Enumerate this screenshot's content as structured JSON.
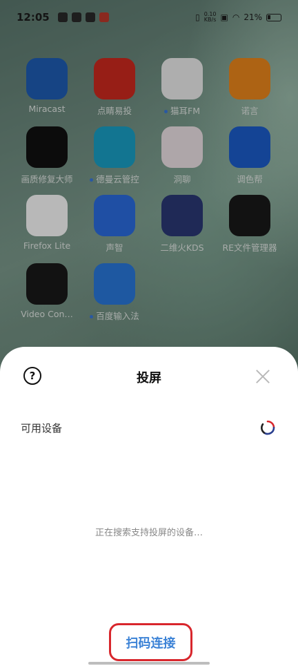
{
  "status_bar": {
    "time": "12:05",
    "net_speed_value": "0.10",
    "net_speed_unit": "KB/s",
    "battery": "21%"
  },
  "apps": [
    {
      "label": "Miracast",
      "dot": false,
      "icon": "miracast-icon",
      "color": "#1f5fb8"
    },
    {
      "label": "点睛易投",
      "dot": false,
      "icon": "dianjing-icon",
      "color": "#d12a1f"
    },
    {
      "label": "猫耳FM",
      "dot": true,
      "icon": "maoer-icon",
      "color": "#f2f2f2"
    },
    {
      "label": "诺言",
      "dot": false,
      "icon": "nuoyan-icon",
      "color": "#f08a1d"
    },
    {
      "label": "画质修复大师",
      "dot": false,
      "icon": "huazhi-icon",
      "color": "#111111"
    },
    {
      "label": "德曼云管控",
      "dot": true,
      "icon": "deman-icon",
      "color": "#1aa3c9"
    },
    {
      "label": "洞聊",
      "dot": false,
      "icon": "dongliao-icon",
      "color": "#f2e6ea"
    },
    {
      "label": "调色帮",
      "dot": false,
      "icon": "tiaoseban-icon",
      "color": "#1d5fcf"
    },
    {
      "label": "Firefox Lite",
      "dot": false,
      "icon": "firefox-lite-icon",
      "color": "#ffffff"
    },
    {
      "label": "声智",
      "dot": false,
      "icon": "shengzhi-icon",
      "color": "#2b6ee3"
    },
    {
      "label": "二维火KDS",
      "dot": false,
      "icon": "kds-icon",
      "color": "#2b3a78"
    },
    {
      "label": "RE文件管理器",
      "dot": false,
      "icon": "re-file-manager-icon",
      "color": "#1a1a1a"
    },
    {
      "label": "Video Con…",
      "dot": false,
      "icon": "video-converter-icon",
      "color": "#1a1a1a"
    },
    {
      "label": "百度输入法",
      "dot": true,
      "icon": "baidu-input-icon",
      "color": "#2a7ae0"
    }
  ],
  "sheet": {
    "title": "投屏",
    "help_glyph": "?",
    "section_label": "可用设备",
    "searching_text": "正在搜索支持投屏的设备…",
    "scan_label": "扫码连接"
  },
  "colors": {
    "accent_blue": "#3b82d6",
    "highlight_red": "#d8262c"
  }
}
